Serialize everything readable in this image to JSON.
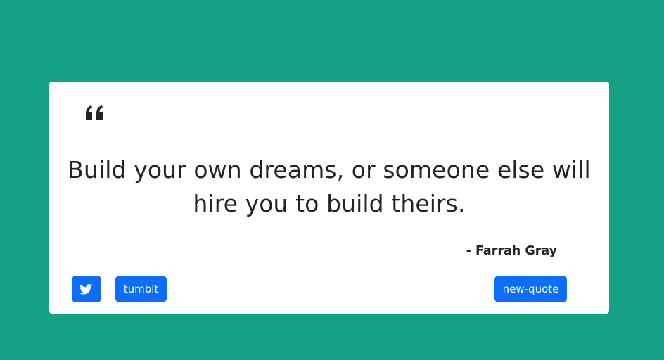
{
  "quote": {
    "icon": "quote-left-icon",
    "text": "Build your own dreams, or someone else will hire you to build theirs.",
    "author": "- Farrah Gray"
  },
  "buttons": {
    "twitter_icon": "twitter-icon",
    "tumblr_label": "tumblt",
    "new_quote_label": "new-quote"
  },
  "colors": {
    "background": "#16a085",
    "card": "#ffffff",
    "text": "#212529",
    "button": "#0d6efd"
  }
}
